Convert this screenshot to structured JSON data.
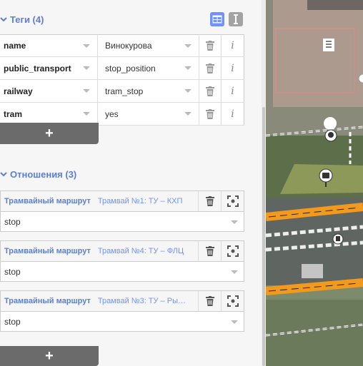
{
  "tags_section": {
    "title": "Теги (4)"
  },
  "tags": [
    {
      "key": "name",
      "value": "Винокурова"
    },
    {
      "key": "public_transport",
      "value": "stop_position"
    },
    {
      "key": "railway",
      "value": "tram_stop"
    },
    {
      "key": "tram",
      "value": "yes"
    }
  ],
  "add_label": "+",
  "relations_section": {
    "title": "Отношения (3)"
  },
  "relations": [
    {
      "type": "Трамвайный маршрут",
      "name": "Трамвай №1: ТУ – КХП",
      "role": "stop"
    },
    {
      "type": "Трамвайный маршрут",
      "name": "Трамвай №4: ТУ – ФЛЦ",
      "role": "stop"
    },
    {
      "type": "Трамвайный маршрут",
      "name": "Трамвай №3: ТУ – Ры…",
      "role": "stop"
    }
  ],
  "info_glyph": "i",
  "colors": {
    "accent": "#7092ff",
    "heading": "#5b7fd8",
    "road": "#f29a1e"
  }
}
